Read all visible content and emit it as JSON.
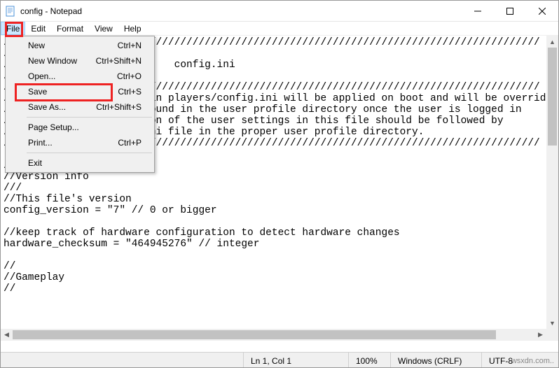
{
  "window": {
    "title": "config - Notepad"
  },
  "menubar": {
    "file": "File",
    "edit": "Edit",
    "format": "Format",
    "view": "View",
    "help": "Help"
  },
  "file_menu": {
    "new": {
      "label": "New",
      "shortcut": "Ctrl+N"
    },
    "new_window": {
      "label": "New Window",
      "shortcut": "Ctrl+Shift+N"
    },
    "open": {
      "label": "Open...",
      "shortcut": "Ctrl+O"
    },
    "save": {
      "label": "Save",
      "shortcut": "Ctrl+S"
    },
    "save_as": {
      "label": "Save As...",
      "shortcut": "Ctrl+Shift+S"
    },
    "page_setup": {
      "label": "Page Setup...",
      "shortcut": ""
    },
    "print": {
      "label": "Print...",
      "shortcut": "Ctrl+P"
    },
    "exit": {
      "label": "Exit",
      "shortcut": ""
    }
  },
  "content": "////////////////////////////////////////////////////////////////////////////////////////\n//\n//                          config.ini\n//\n////////////////////////////////////////////////////////////////////////////////////////\n//CAUTION: the settings in players/config.ini will be applied on boot and will be overridden.\n//by the user settings found in the user profile directory once the user is logged in\n//so any permanent edition of the user settings in this file should be followed by\n//a copy of the config.ini file in the proper user profile directory.\n////////////////////////////////////////////////////////////////////////////////////////\n\n//\n//Version info\n///\n//This file's version\nconfig_version = \"7\" // 0 or bigger\n\n//keep track of hardware configuration to detect hardware changes\nhardware_checksum = \"464945276\" // integer\n\n//\n//Gameplay\n//",
  "status": {
    "position": "Ln 1, Col 1",
    "zoom": "100%",
    "line_ending": "Windows (CRLF)",
    "encoding": "UTF-8"
  },
  "watermark": "wsxdn.com.."
}
